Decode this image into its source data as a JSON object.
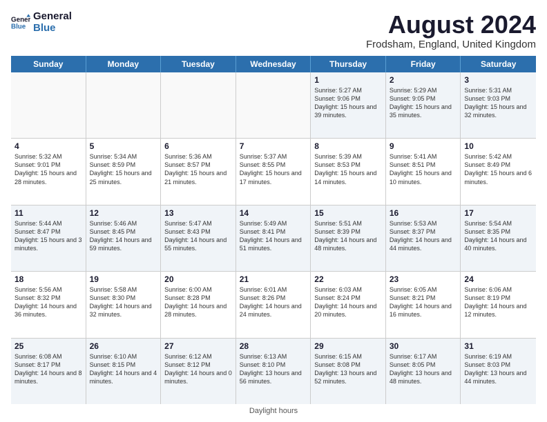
{
  "logo": {
    "text_general": "General",
    "text_blue": "Blue"
  },
  "title": "August 2024",
  "subtitle": "Frodsham, England, United Kingdom",
  "days_of_week": [
    "Sunday",
    "Monday",
    "Tuesday",
    "Wednesday",
    "Thursday",
    "Friday",
    "Saturday"
  ],
  "footer": "Daylight hours",
  "weeks": [
    [
      {
        "day": "",
        "sunrise": "",
        "sunset": "",
        "daylight": "",
        "empty": true
      },
      {
        "day": "",
        "sunrise": "",
        "sunset": "",
        "daylight": "",
        "empty": true
      },
      {
        "day": "",
        "sunrise": "",
        "sunset": "",
        "daylight": "",
        "empty": true
      },
      {
        "day": "",
        "sunrise": "",
        "sunset": "",
        "daylight": "",
        "empty": true
      },
      {
        "day": "1",
        "sunrise": "Sunrise: 5:27 AM",
        "sunset": "Sunset: 9:06 PM",
        "daylight": "Daylight: 15 hours and 39 minutes.",
        "empty": false
      },
      {
        "day": "2",
        "sunrise": "Sunrise: 5:29 AM",
        "sunset": "Sunset: 9:05 PM",
        "daylight": "Daylight: 15 hours and 35 minutes.",
        "empty": false
      },
      {
        "day": "3",
        "sunrise": "Sunrise: 5:31 AM",
        "sunset": "Sunset: 9:03 PM",
        "daylight": "Daylight: 15 hours and 32 minutes.",
        "empty": false
      }
    ],
    [
      {
        "day": "4",
        "sunrise": "Sunrise: 5:32 AM",
        "sunset": "Sunset: 9:01 PM",
        "daylight": "Daylight: 15 hours and 28 minutes.",
        "empty": false
      },
      {
        "day": "5",
        "sunrise": "Sunrise: 5:34 AM",
        "sunset": "Sunset: 8:59 PM",
        "daylight": "Daylight: 15 hours and 25 minutes.",
        "empty": false
      },
      {
        "day": "6",
        "sunrise": "Sunrise: 5:36 AM",
        "sunset": "Sunset: 8:57 PM",
        "daylight": "Daylight: 15 hours and 21 minutes.",
        "empty": false
      },
      {
        "day": "7",
        "sunrise": "Sunrise: 5:37 AM",
        "sunset": "Sunset: 8:55 PM",
        "daylight": "Daylight: 15 hours and 17 minutes.",
        "empty": false
      },
      {
        "day": "8",
        "sunrise": "Sunrise: 5:39 AM",
        "sunset": "Sunset: 8:53 PM",
        "daylight": "Daylight: 15 hours and 14 minutes.",
        "empty": false
      },
      {
        "day": "9",
        "sunrise": "Sunrise: 5:41 AM",
        "sunset": "Sunset: 8:51 PM",
        "daylight": "Daylight: 15 hours and 10 minutes.",
        "empty": false
      },
      {
        "day": "10",
        "sunrise": "Sunrise: 5:42 AM",
        "sunset": "Sunset: 8:49 PM",
        "daylight": "Daylight: 15 hours and 6 minutes.",
        "empty": false
      }
    ],
    [
      {
        "day": "11",
        "sunrise": "Sunrise: 5:44 AM",
        "sunset": "Sunset: 8:47 PM",
        "daylight": "Daylight: 15 hours and 3 minutes.",
        "empty": false
      },
      {
        "day": "12",
        "sunrise": "Sunrise: 5:46 AM",
        "sunset": "Sunset: 8:45 PM",
        "daylight": "Daylight: 14 hours and 59 minutes.",
        "empty": false
      },
      {
        "day": "13",
        "sunrise": "Sunrise: 5:47 AM",
        "sunset": "Sunset: 8:43 PM",
        "daylight": "Daylight: 14 hours and 55 minutes.",
        "empty": false
      },
      {
        "day": "14",
        "sunrise": "Sunrise: 5:49 AM",
        "sunset": "Sunset: 8:41 PM",
        "daylight": "Daylight: 14 hours and 51 minutes.",
        "empty": false
      },
      {
        "day": "15",
        "sunrise": "Sunrise: 5:51 AM",
        "sunset": "Sunset: 8:39 PM",
        "daylight": "Daylight: 14 hours and 48 minutes.",
        "empty": false
      },
      {
        "day": "16",
        "sunrise": "Sunrise: 5:53 AM",
        "sunset": "Sunset: 8:37 PM",
        "daylight": "Daylight: 14 hours and 44 minutes.",
        "empty": false
      },
      {
        "day": "17",
        "sunrise": "Sunrise: 5:54 AM",
        "sunset": "Sunset: 8:35 PM",
        "daylight": "Daylight: 14 hours and 40 minutes.",
        "empty": false
      }
    ],
    [
      {
        "day": "18",
        "sunrise": "Sunrise: 5:56 AM",
        "sunset": "Sunset: 8:32 PM",
        "daylight": "Daylight: 14 hours and 36 minutes.",
        "empty": false
      },
      {
        "day": "19",
        "sunrise": "Sunrise: 5:58 AM",
        "sunset": "Sunset: 8:30 PM",
        "daylight": "Daylight: 14 hours and 32 minutes.",
        "empty": false
      },
      {
        "day": "20",
        "sunrise": "Sunrise: 6:00 AM",
        "sunset": "Sunset: 8:28 PM",
        "daylight": "Daylight: 14 hours and 28 minutes.",
        "empty": false
      },
      {
        "day": "21",
        "sunrise": "Sunrise: 6:01 AM",
        "sunset": "Sunset: 8:26 PM",
        "daylight": "Daylight: 14 hours and 24 minutes.",
        "empty": false
      },
      {
        "day": "22",
        "sunrise": "Sunrise: 6:03 AM",
        "sunset": "Sunset: 8:24 PM",
        "daylight": "Daylight: 14 hours and 20 minutes.",
        "empty": false
      },
      {
        "day": "23",
        "sunrise": "Sunrise: 6:05 AM",
        "sunset": "Sunset: 8:21 PM",
        "daylight": "Daylight: 14 hours and 16 minutes.",
        "empty": false
      },
      {
        "day": "24",
        "sunrise": "Sunrise: 6:06 AM",
        "sunset": "Sunset: 8:19 PM",
        "daylight": "Daylight: 14 hours and 12 minutes.",
        "empty": false
      }
    ],
    [
      {
        "day": "25",
        "sunrise": "Sunrise: 6:08 AM",
        "sunset": "Sunset: 8:17 PM",
        "daylight": "Daylight: 14 hours and 8 minutes.",
        "empty": false
      },
      {
        "day": "26",
        "sunrise": "Sunrise: 6:10 AM",
        "sunset": "Sunset: 8:15 PM",
        "daylight": "Daylight: 14 hours and 4 minutes.",
        "empty": false
      },
      {
        "day": "27",
        "sunrise": "Sunrise: 6:12 AM",
        "sunset": "Sunset: 8:12 PM",
        "daylight": "Daylight: 14 hours and 0 minutes.",
        "empty": false
      },
      {
        "day": "28",
        "sunrise": "Sunrise: 6:13 AM",
        "sunset": "Sunset: 8:10 PM",
        "daylight": "Daylight: 13 hours and 56 minutes.",
        "empty": false
      },
      {
        "day": "29",
        "sunrise": "Sunrise: 6:15 AM",
        "sunset": "Sunset: 8:08 PM",
        "daylight": "Daylight: 13 hours and 52 minutes.",
        "empty": false
      },
      {
        "day": "30",
        "sunrise": "Sunrise: 6:17 AM",
        "sunset": "Sunset: 8:05 PM",
        "daylight": "Daylight: 13 hours and 48 minutes.",
        "empty": false
      },
      {
        "day": "31",
        "sunrise": "Sunrise: 6:19 AM",
        "sunset": "Sunset: 8:03 PM",
        "daylight": "Daylight: 13 hours and 44 minutes.",
        "empty": false
      }
    ]
  ]
}
